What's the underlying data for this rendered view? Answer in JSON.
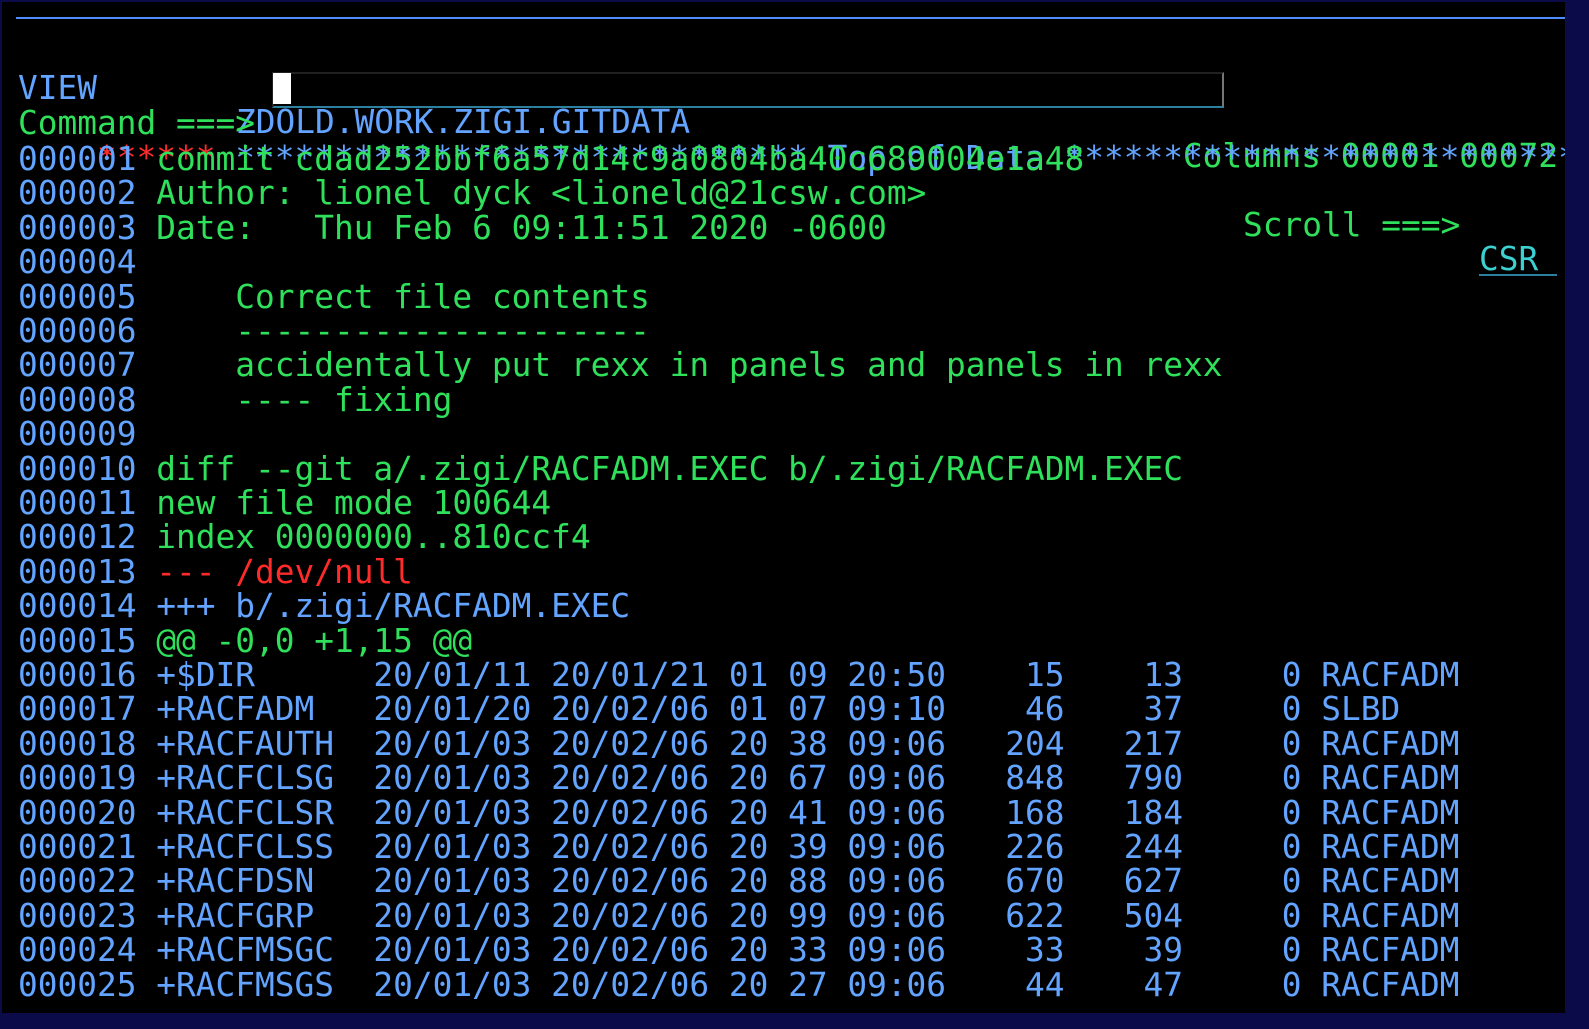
{
  "header": {
    "mode": "VIEW",
    "dataset": "ZDOLD.WORK.ZIGI.GITDATA",
    "columns": "Columns 00001 00072",
    "command_label": "Command ===>",
    "command_value": "",
    "scroll_label": "Scroll ===>",
    "scroll_value": "CSR"
  },
  "top_marker": {
    "stars": "******",
    "text": "***************************** Top of Data ******************************"
  },
  "lines": [
    {
      "num": "000001",
      "text": "commit cdad252bbf6a57d14c9a0804ba40c689004e1a48",
      "color": "green"
    },
    {
      "num": "000002",
      "text": "Author: lionel dyck <lioneld@21csw.com>",
      "color": "green"
    },
    {
      "num": "000003",
      "text": "Date:   Thu Feb 6 09:11:51 2020 -0600",
      "color": "green"
    },
    {
      "num": "000004",
      "text": "",
      "color": "green"
    },
    {
      "num": "000005",
      "text": "    Correct file contents",
      "color": "green"
    },
    {
      "num": "000006",
      "text": "    ---------------------",
      "color": "green"
    },
    {
      "num": "000007",
      "text": "    accidentally put rexx in panels and panels in rexx",
      "color": "green"
    },
    {
      "num": "000008",
      "text": "    ---- fixing",
      "color": "green"
    },
    {
      "num": "000009",
      "text": "",
      "color": "green"
    },
    {
      "num": "000010",
      "text": "diff --git a/.zigi/RACFADM.EXEC b/.zigi/RACFADM.EXEC",
      "color": "green"
    },
    {
      "num": "000011",
      "text": "new file mode 100644",
      "color": "green"
    },
    {
      "num": "000012",
      "text": "index 0000000..810ccf4",
      "color": "green"
    },
    {
      "num": "000013",
      "text": "--- /dev/null",
      "color": "red"
    },
    {
      "num": "000014",
      "text": "+++ b/.zigi/RACFADM.EXEC",
      "color": "blue"
    },
    {
      "num": "000015",
      "text": "@@ -0,0 +1,15 @@",
      "color": "green"
    },
    {
      "num": "000016",
      "text": "+$DIR      20/01/11 20/01/21 01 09 20:50    15    13     0 RACFADM",
      "color": "blue"
    },
    {
      "num": "000017",
      "text": "+RACFADM   20/01/20 20/02/06 01 07 09:10    46    37     0 SLBD",
      "color": "blue"
    },
    {
      "num": "000018",
      "text": "+RACFAUTH  20/01/03 20/02/06 20 38 09:06   204   217     0 RACFADM",
      "color": "blue"
    },
    {
      "num": "000019",
      "text": "+RACFCLSG  20/01/03 20/02/06 20 67 09:06   848   790     0 RACFADM",
      "color": "blue"
    },
    {
      "num": "000020",
      "text": "+RACFCLSR  20/01/03 20/02/06 20 41 09:06   168   184     0 RACFADM",
      "color": "blue"
    },
    {
      "num": "000021",
      "text": "+RACFCLSS  20/01/03 20/02/06 20 39 09:06   226   244     0 RACFADM",
      "color": "blue"
    },
    {
      "num": "000022",
      "text": "+RACFDSN   20/01/03 20/02/06 20 88 09:06   670   627     0 RACFADM",
      "color": "blue"
    },
    {
      "num": "000023",
      "text": "+RACFGRP   20/01/03 20/02/06 20 99 09:06   622   504     0 RACFADM",
      "color": "blue"
    },
    {
      "num": "000024",
      "text": "+RACFMSGC  20/01/03 20/02/06 20 33 09:06    33    39     0 RACFADM",
      "color": "blue"
    },
    {
      "num": "000025",
      "text": "+RACFMSGS  20/01/03 20/02/06 20 27 09:06    44    47     0 RACFADM",
      "color": "blue"
    }
  ],
  "colors": {
    "background": "#000000",
    "frame": "#0b0b4a",
    "blue": "#62a4ff",
    "green": "#2fe05b",
    "red": "#ff2b2b",
    "cyan": "#3cd0d0",
    "cursor": "#ffffff"
  }
}
